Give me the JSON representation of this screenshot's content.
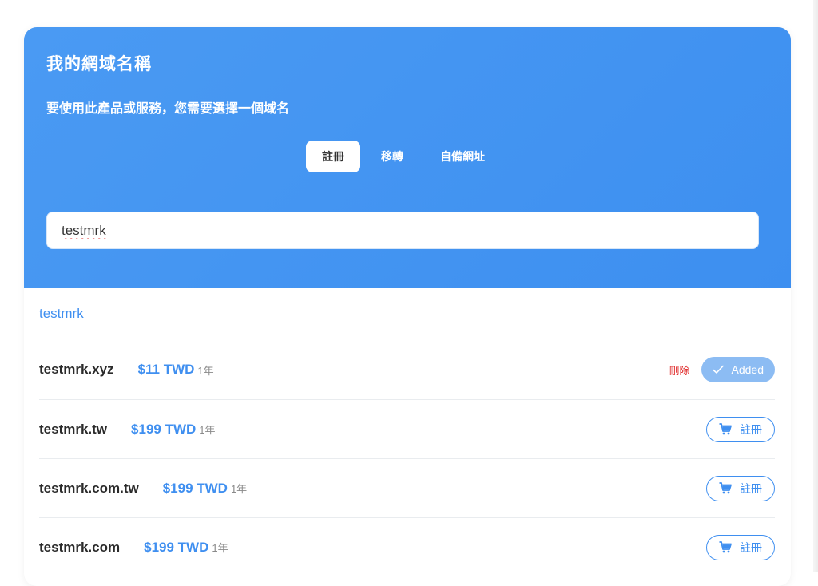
{
  "header": {
    "title": "我的網域名稱",
    "subtitle": "要使用此產品或服務，您需要選擇一個域名"
  },
  "tabs": [
    {
      "label": "註冊",
      "active": true
    },
    {
      "label": "移轉",
      "active": false
    },
    {
      "label": "自備網址",
      "active": false
    }
  ],
  "search": {
    "value": "testmrk"
  },
  "results": {
    "query_label": "testmrk",
    "items": [
      {
        "domain": "testmrk.xyz",
        "price": "$11 TWD",
        "term": "1年",
        "status": "added",
        "remove_label": "刪除",
        "button_label": "Added"
      },
      {
        "domain": "testmrk.tw",
        "price": "$199 TWD",
        "term": "1年",
        "status": "available",
        "button_label": "註冊"
      },
      {
        "domain": "testmrk.com.tw",
        "price": "$199 TWD",
        "term": "1年",
        "status": "available",
        "button_label": "註冊"
      },
      {
        "domain": "testmrk.com",
        "price": "$199 TWD",
        "term": "1年",
        "status": "available",
        "button_label": "註冊"
      }
    ]
  },
  "colors": {
    "accent": "#3f8ff0",
    "hero_bg": "#4a9af3",
    "danger": "#e02b2b",
    "added_bg": "#8cbcf3"
  },
  "icons": {
    "check": "check-icon",
    "cart": "cart-icon"
  }
}
